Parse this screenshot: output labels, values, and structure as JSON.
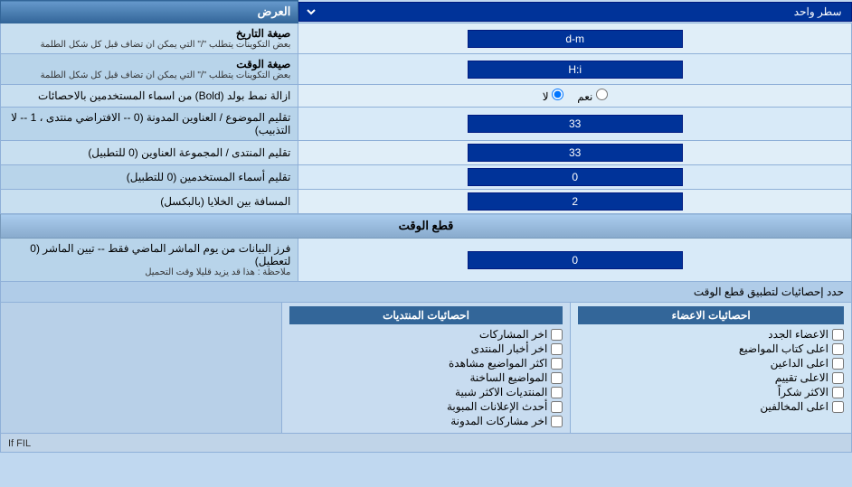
{
  "header": {
    "title": "العرض",
    "single_row_label": "سطر واحد"
  },
  "rows": [
    {
      "id": "date_format",
      "label": "صيغة التاريخ",
      "sublabel": "بعض التكوينات يتطلب \"/\" التي يمكن ان تضاف قبل كل شكل الطلمة",
      "value": "d-m",
      "type": "input"
    },
    {
      "id": "time_format",
      "label": "صيغة الوقت",
      "sublabel": "بعض التكوينات يتطلب \"/\" التي يمكن ان تضاف قبل كل شكل الطلمة",
      "value": "H:i",
      "type": "input"
    },
    {
      "id": "bold_remove",
      "label": "ازالة نمط بولد (Bold) من اسماء المستخدمين بالاحصائات",
      "radio_yes": "نعم",
      "radio_no": "لا",
      "selected": "no",
      "type": "radio"
    },
    {
      "id": "subject_titles",
      "label": "تقليم الموضوع / العناوين المدونة (0 -- الافتراضي منتدى ، 1 -- لا التذبيب)",
      "value": "33",
      "type": "input"
    },
    {
      "id": "forum_group",
      "label": "تقليم المنتدى / المجموعة العناوين (0 للتطبيل)",
      "value": "33",
      "type": "input"
    },
    {
      "id": "usernames",
      "label": "تقليم أسماء المستخدمين (0 للتطبيل)",
      "value": "0",
      "type": "input"
    },
    {
      "id": "cell_spacing",
      "label": "المسافة بين الخلايا (بالبكسل)",
      "value": "2",
      "type": "input"
    }
  ],
  "cutoff_section": {
    "title": "قطع الوقت",
    "row": {
      "label": "فرز البيانات من يوم الماشر الماضي فقط -- تيين الماشر (0 لتعطيل)",
      "sublabel": "ملاحظة : هذا قد يزيد قليلا وقت التحميل",
      "value": "0"
    },
    "apply_label": "حدد إحصائيات لتطبيق قطع الوقت"
  },
  "stats": {
    "posts_header": "احصائيات المنتديات",
    "members_header": "احصائيات الاعضاء",
    "posts_items": [
      "اخر المشاركات",
      "اخر أخبار المنتدى",
      "اكثر المواضيع مشاهدة",
      "المواضيع الساخنة",
      "المنتديات الاكثر شبية",
      "أحدث الإعلانات المبوبة",
      "اخر مشاركات المدونة"
    ],
    "members_items": [
      "الاعضاء الجدد",
      "اعلى كتاب المواضيع",
      "اعلى الداعين",
      "الاعلى تقييم",
      "الاكثر شكراً",
      "اعلى المخالفين"
    ]
  },
  "bottom_text": "If FIL"
}
